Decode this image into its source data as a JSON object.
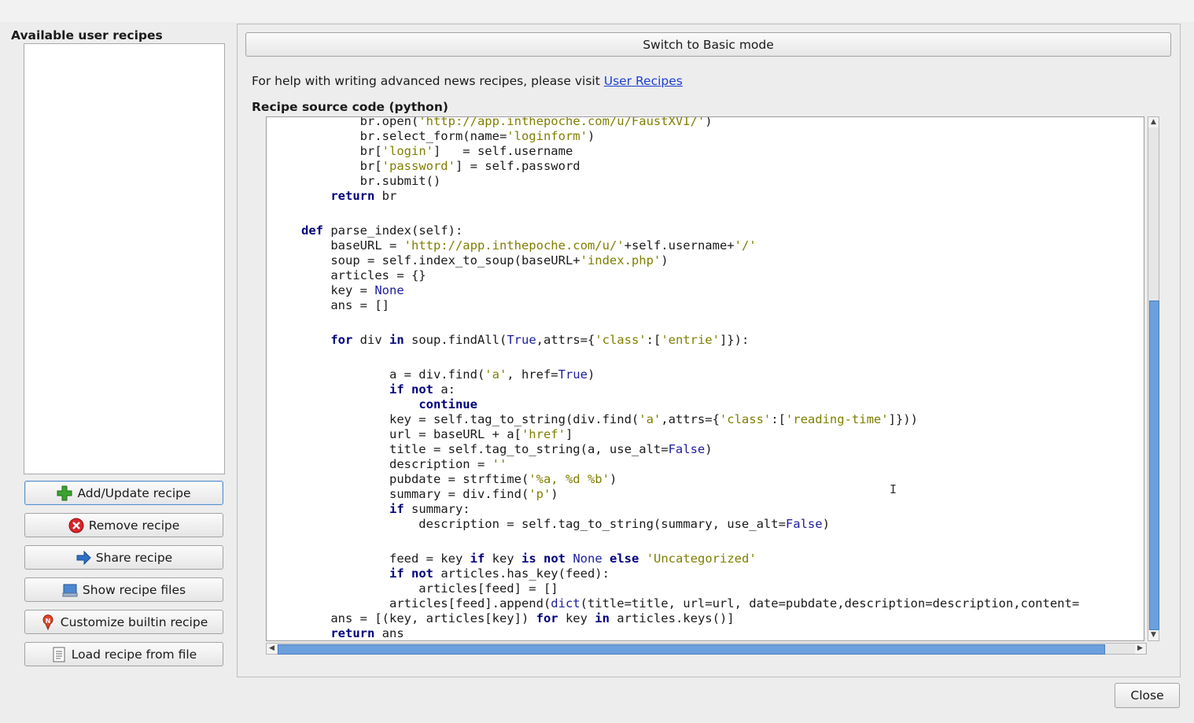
{
  "left": {
    "title": "Available user recipes",
    "buttons": [
      {
        "label": "Add/Update recipe",
        "icon": "plus-icon"
      },
      {
        "label": "Remove recipe",
        "icon": "remove-icon"
      },
      {
        "label": "Share recipe",
        "icon": "share-arrow-icon"
      },
      {
        "label": "Show recipe files",
        "icon": "folder-files-icon"
      },
      {
        "label": "Customize builtin recipe",
        "icon": "builtin-recipe-icon"
      },
      {
        "label": "Load recipe from file",
        "icon": "document-icon"
      }
    ]
  },
  "right": {
    "mode_button": "Switch to Basic mode",
    "help_text": "For help with writing advanced news recipes, please visit",
    "help_link": "User Recipes",
    "source_label": "Recipe source code (python)"
  },
  "code_lines": [
    "        br.open('http://app.inthepoche.com/u/FaustXVI/')",
    "        br.select_form(name='loginform')",
    "        br['login']   = self.username",
    "        br['password'] = self.password",
    "        br.submit()",
    "    return br",
    "",
    "def parse_index(self):",
    "    baseURL = 'http://app.inthepoche.com/u/'+self.username+'/'",
    "    soup = self.index_to_soup(baseURL+'index.php')",
    "    articles = {}",
    "    key = None",
    "    ans = []",
    "",
    "    for div in soup.findAll(True,attrs={'class':['entrie']}):",
    "",
    "            a = div.find('a', href=True)",
    "            if not a:",
    "                continue",
    "            key = self.tag_to_string(div.find('a',attrs={'class':['reading-time']}))",
    "            url = baseURL + a['href']",
    "            title = self.tag_to_string(a, use_alt=False)",
    "            description = ''",
    "            pubdate = strftime('%a, %d %b')",
    "            summary = div.find('p')",
    "            if summary:",
    "                description = self.tag_to_string(summary, use_alt=False)",
    "",
    "            feed = key if key is not None else 'Uncategorized'",
    "            if not articles.has_key(feed):",
    "                articles[feed] = []",
    "            articles[feed].append(dict(title=title, url=url, date=pubdate,description=description,content=",
    "    ans = [(key, articles[key]) for key in articles.keys()]",
    "    return ans"
  ],
  "close_button": "Close",
  "colors": {
    "keyword": "#00007f",
    "string": "#7f7f00",
    "builtin": "#1c1c9e",
    "scroll_thumb": "#6ca0dc",
    "link": "#1c3fd1"
  }
}
